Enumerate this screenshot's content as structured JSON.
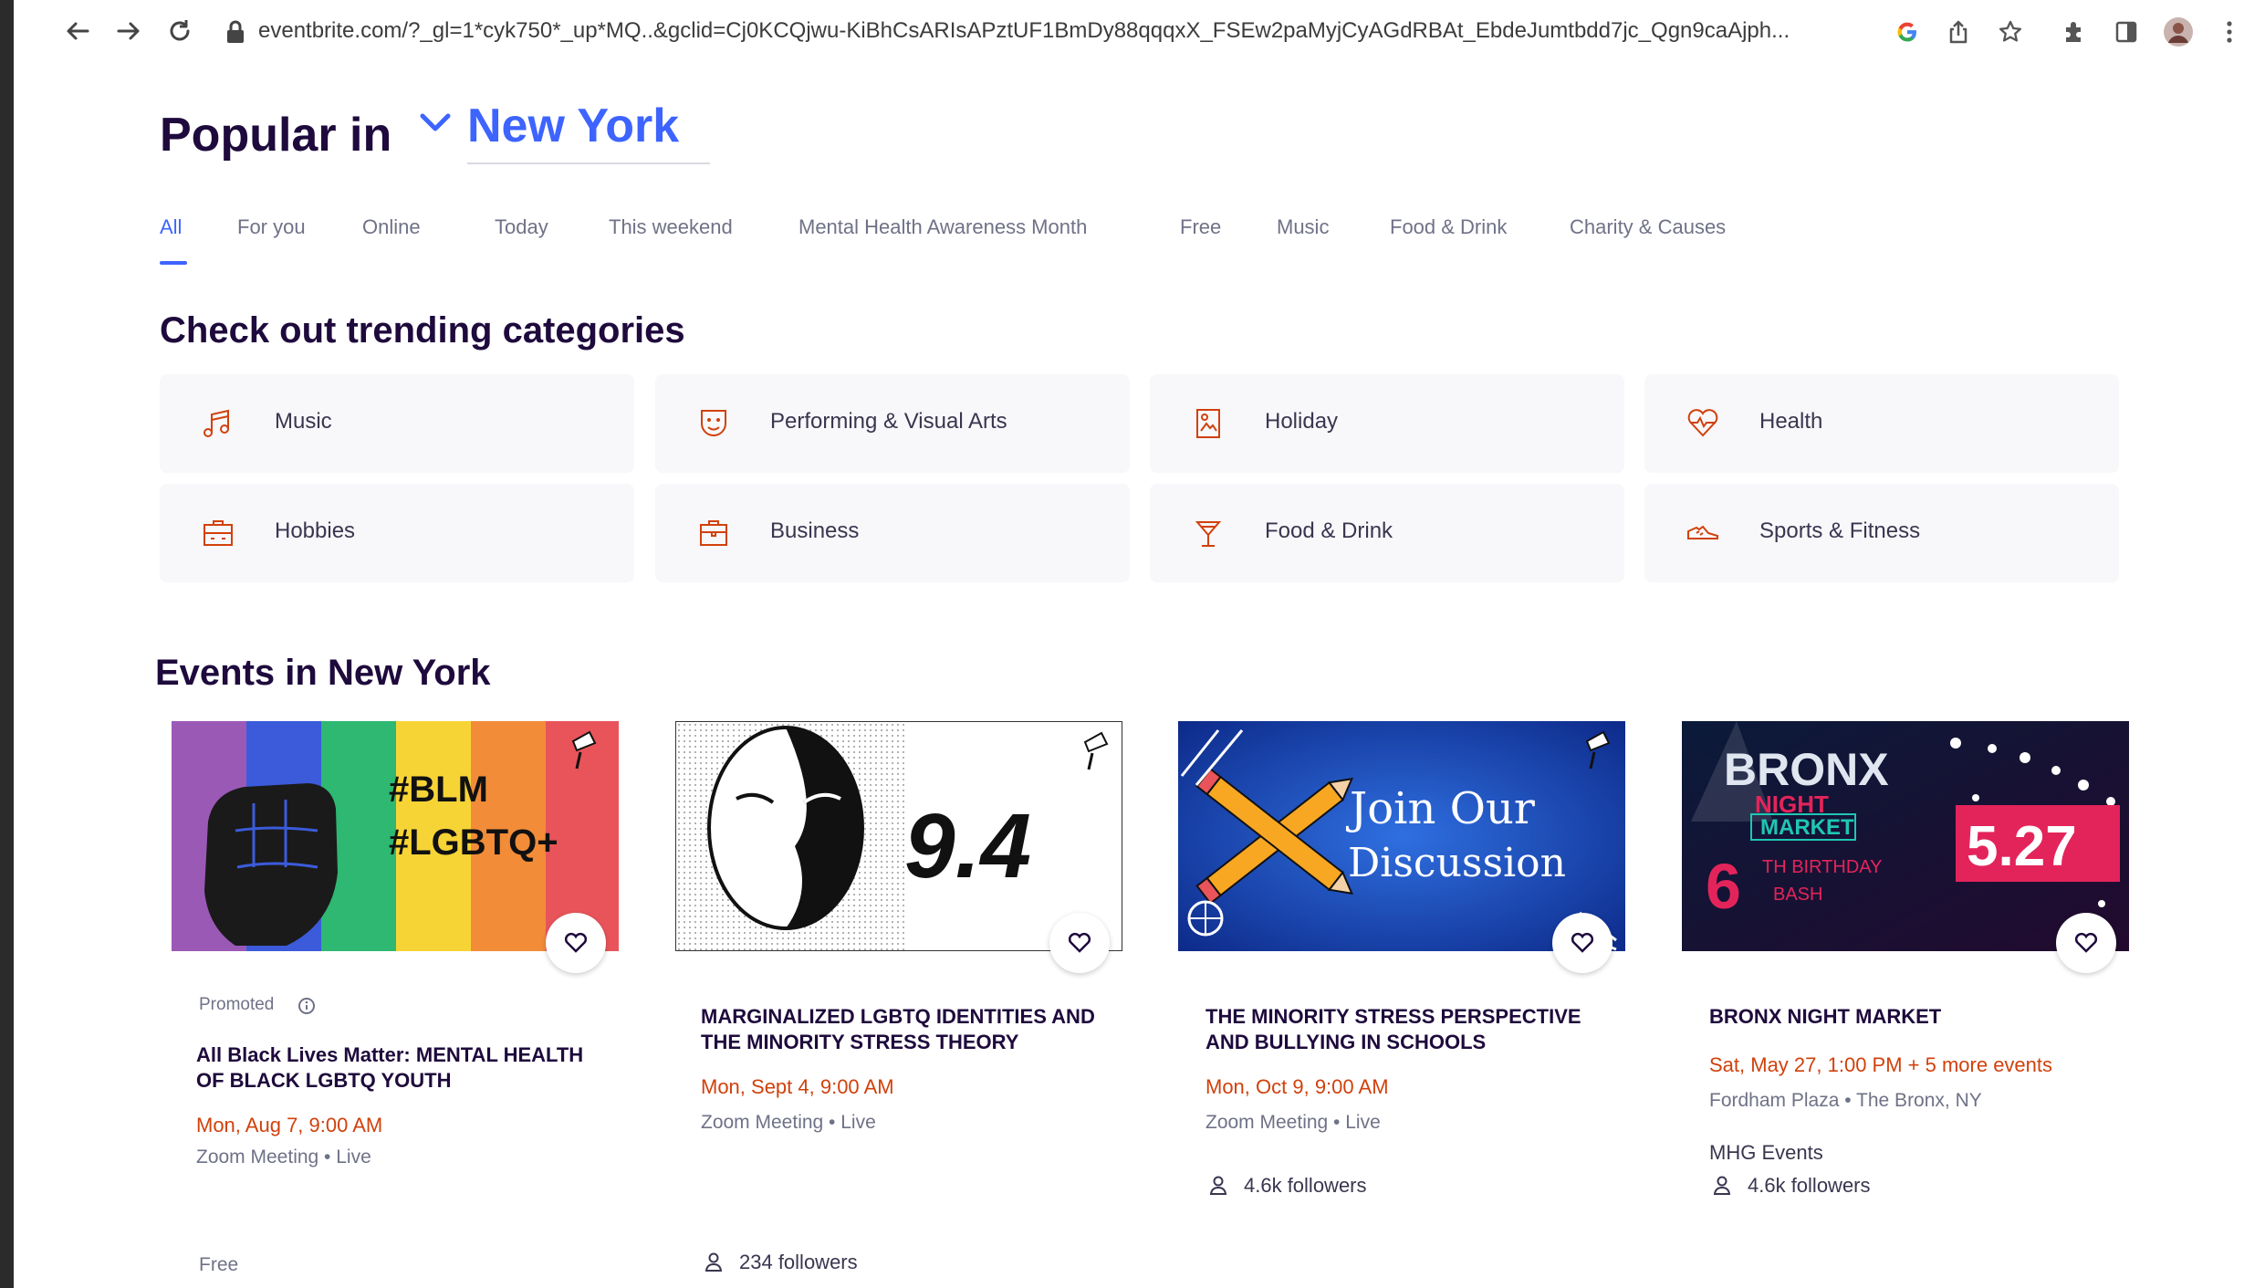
{
  "browser": {
    "url": "eventbrite.com/?_gl=1*cyk750*_up*MQ..&gclid=Cj0KCQjwu-KiBhCsARIsAPztUF1BmDy88qqqxX_FSEw2paMyjCyAGdRBAt_EbdeJumtbdd7jc_Qgn9caAjph..."
  },
  "header": {
    "popular_in": "Popular in",
    "location": "New York"
  },
  "tabs": [
    {
      "label": "All"
    },
    {
      "label": "For you"
    },
    {
      "label": "Online"
    },
    {
      "label": "Today"
    },
    {
      "label": "This weekend"
    },
    {
      "label": "Mental Health Awareness Month"
    },
    {
      "label": "Free"
    },
    {
      "label": "Music"
    },
    {
      "label": "Food & Drink"
    },
    {
      "label": "Charity & Causes"
    }
  ],
  "trending": {
    "title": "Check out trending categories",
    "categories": [
      {
        "label": "Music",
        "icon": "music-icon"
      },
      {
        "label": "Performing & Visual Arts",
        "icon": "theater-mask-icon"
      },
      {
        "label": "Holiday",
        "icon": "calendar-image-icon"
      },
      {
        "label": "Health",
        "icon": "heart-pulse-icon"
      },
      {
        "label": "Hobbies",
        "icon": "hobbies-icon"
      },
      {
        "label": "Business",
        "icon": "briefcase-icon"
      },
      {
        "label": "Food & Drink",
        "icon": "cocktail-icon"
      },
      {
        "label": "Sports & Fitness",
        "icon": "sneaker-icon"
      }
    ]
  },
  "events": {
    "title": "Events in New York",
    "cards": [
      {
        "image_text_1": "#BLM",
        "image_text_2": "#LGBTQ+",
        "promoted": "Promoted",
        "title": "All Black Lives Matter: MENTAL HEALTH OF BLACK LGBTQ YOUTH",
        "date": "Mon, Aug 7, 9:00 AM",
        "location": "Zoom Meeting • Live",
        "price": "Free"
      },
      {
        "image_text": "9.4",
        "title": "MARGINALIZED LGBTQ IDENTITIES AND THE MINORITY STRESS THEORY",
        "date": "Mon, Sept 4, 9:00 AM",
        "location": "Zoom Meeting • Live",
        "followers": "234 followers"
      },
      {
        "image_text": "Join Our Discussion",
        "title": "THE MINORITY STRESS PERSPECTIVE AND BULLYING IN SCHOOLS",
        "date": "Mon, Oct 9, 9:00 AM",
        "location": "Zoom Meeting • Live",
        "followers": "4.6k followers"
      },
      {
        "image_text_1": "BRONX",
        "image_text_2": "NIGHT",
        "image_text_3": "MARKET",
        "image_text_4": "6",
        "image_text_5": "TH BIRTHDAY",
        "image_text_6": "BASH",
        "image_text_7": "5.27",
        "title": "BRONX NIGHT MARKET",
        "date": "Sat, May 27, 1:00 PM + 5 more events",
        "location": "Fordham Plaza • The Bronx, NY",
        "organizer": "MHG Events",
        "followers": "4.6k followers"
      }
    ]
  },
  "colors": {
    "accent": "#3d64ff",
    "date": "#d1410c",
    "icon": "#d1410c"
  }
}
